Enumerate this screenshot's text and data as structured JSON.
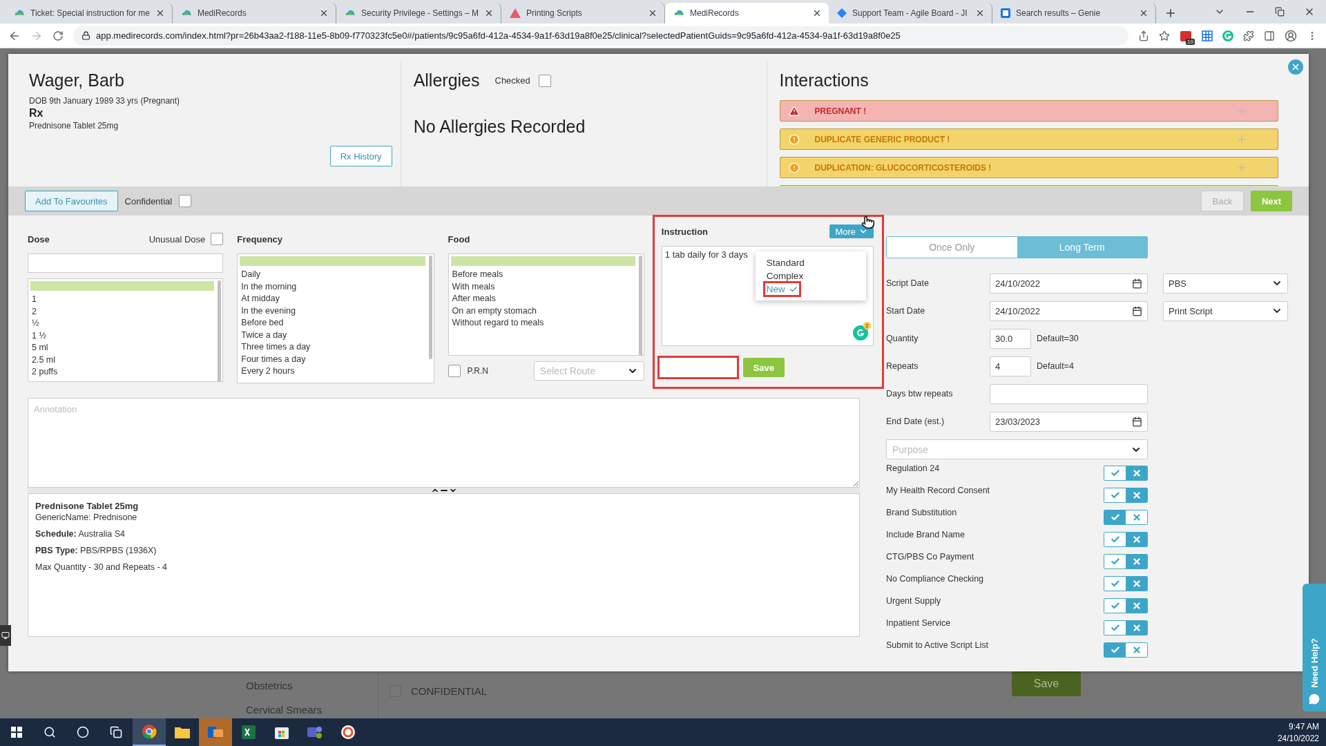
{
  "browser": {
    "tabs": [
      {
        "title": "Ticket: Special instruction for me",
        "kind": "cloud",
        "selected": false
      },
      {
        "title": "MediRecords",
        "kind": "cloud",
        "selected": false
      },
      {
        "title": "Security Privilege - Settings – M",
        "kind": "cloud",
        "selected": false
      },
      {
        "title": "Printing Scripts",
        "kind": "alert",
        "selected": false
      },
      {
        "title": "MediRecords",
        "kind": "cloud",
        "selected": true
      },
      {
        "title": "Support Team - Agile Board - JI",
        "kind": "diamond",
        "selected": false
      },
      {
        "title": "Search results – Genie",
        "kind": "square",
        "selected": false
      }
    ],
    "url": "app.medirecords.com/index.html?pr=26b43aa2-f188-11e5-8b09-f770323fc5e0#/patients/9c95a6fd-412a-4534-9a1f-63d19a8f0e25/clinical?selectedPatientGuids=9c95a6fd-412a-4534-9a1f-63d19a8f0e25",
    "extension_badge": "10"
  },
  "patient": {
    "name": "Wager, Barb",
    "dob": "DOB 9th January 1989 33 yrs (Pregnant)",
    "section": "Rx",
    "drug": "Prednisone Tablet 25mg",
    "history_button": "Rx History"
  },
  "allergies": {
    "title": "Allergies",
    "checked_label": "Checked",
    "checked": false,
    "message": "No Allergies Recorded"
  },
  "interactions": {
    "title": "Interactions",
    "items": [
      {
        "label": "PREGNANT !",
        "kind": "danger",
        "color": "#f5b4b4"
      },
      {
        "label": "DUPLICATE GENERIC PRODUCT !",
        "kind": "warning",
        "color": "#f3d46b"
      },
      {
        "label": "DUPLICATION: GLUCOCORTICOSTEROIDS !",
        "kind": "warning",
        "color": "#f3d46b"
      },
      {
        "kind": "info",
        "color": "#c9f08f"
      }
    ]
  },
  "toolbar": {
    "favourites_button": "Add To Favourites",
    "confidential_label": "Confidential",
    "confidential": false,
    "back_button": "Back",
    "back_disabled": true,
    "next_button": "Next"
  },
  "dose": {
    "title": "Dose",
    "unusual_label": "Unusual Dose",
    "unusual": false,
    "blank_selected": true,
    "items": [
      {
        "label": "1",
        "selected": false
      },
      {
        "label": "2",
        "selected": false
      },
      {
        "label": "½",
        "selected": false
      },
      {
        "label": "1 ½",
        "selected": false
      },
      {
        "label": "5 ml",
        "selected": false
      },
      {
        "label": "2.5 ml",
        "selected": false
      },
      {
        "label": "2 puffs",
        "selected": false
      }
    ]
  },
  "frequency": {
    "title": "Frequency",
    "blank_selected": true,
    "items": [
      {
        "label": "Daily",
        "selected": false
      },
      {
        "label": "In the morning",
        "selected": false
      },
      {
        "label": "At midday",
        "selected": false
      },
      {
        "label": "In the evening",
        "selected": false
      },
      {
        "label": "Before bed",
        "selected": false
      },
      {
        "label": "Twice a day",
        "selected": false
      },
      {
        "label": "Three times a day",
        "selected": false
      },
      {
        "label": "Four times a day",
        "selected": false
      },
      {
        "label": "Every 2 hours",
        "selected": false
      }
    ]
  },
  "food": {
    "title": "Food",
    "blank_selected": true,
    "items": [
      {
        "label": "Before meals",
        "selected": false
      },
      {
        "label": "With meals",
        "selected": false
      },
      {
        "label": "After meals",
        "selected": false
      },
      {
        "label": "On an empty stomach",
        "selected": false
      },
      {
        "label": "Without regard to meals",
        "selected": false
      }
    ],
    "prn_label": "P.R.N",
    "prn": false,
    "route_placeholder": "Select Route"
  },
  "instruction": {
    "title": "Instruction",
    "more_button": "More",
    "value": "1 tab daily for 3 days",
    "menu": [
      {
        "label": "Standard",
        "selected": false
      },
      {
        "label": "Complex",
        "selected": false
      },
      {
        "label": "New",
        "selected": true
      }
    ],
    "grammarly_badge": "2",
    "save_button": "Save"
  },
  "annotation": {
    "placeholder": "Annotation"
  },
  "drug_info": {
    "title": "Prednisone Tablet 25mg",
    "lines": [
      "GenericName: Prednisone",
      "**Schedule:** Australia S4",
      "**PBS Type:** PBS/RPBS (1936X)",
      "Max Quantity - 30 and Repeats - 4"
    ]
  },
  "script": {
    "duration": [
      {
        "label": "Once Only",
        "selected": false
      },
      {
        "label": "Long Term",
        "selected": true
      }
    ],
    "script_date_label": "Script Date",
    "script_date": "24/10/2022",
    "script_type": "PBS",
    "start_date_label": "Start Date",
    "start_date": "24/10/2022",
    "print_option": "Print Script",
    "quantity_label": "Quantity",
    "quantity": "30.0",
    "quantity_default": "Default=30",
    "repeats_label": "Repeats",
    "repeats": "4",
    "repeats_default": "Default=4",
    "days_label": "Days btw repeats",
    "end_date_label": "End Date (est.)",
    "end_date": "23/03/2023",
    "purpose_placeholder": "Purpose",
    "options": [
      {
        "label": "Regulation 24",
        "on": false
      },
      {
        "label": "My Health Record Consent",
        "on": false
      },
      {
        "label": "Brand Substitution",
        "on": true
      },
      {
        "label": "Include Brand Name",
        "on": false
      },
      {
        "label": "CTG/PBS Co Payment",
        "on": false
      },
      {
        "label": "No Compliance Checking",
        "on": false
      },
      {
        "label": "Urgent Supply",
        "on": false
      },
      {
        "label": "Inpatient Service",
        "on": false
      },
      {
        "label": "Submit to Active Script List",
        "on": true
      }
    ]
  },
  "background": {
    "menu": [
      "Obstetrics",
      "Cervical Smears"
    ],
    "confidential": false,
    "confidential_label": "CONFIDENTIAL",
    "save_button": "Save",
    "help_tab": "Need Help?"
  },
  "taskbar": {
    "time": "9:47 AM",
    "date": "24/10/2022"
  }
}
